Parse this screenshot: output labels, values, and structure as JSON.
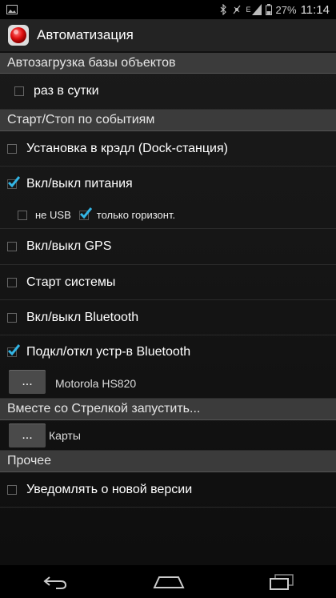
{
  "status_bar": {
    "battery": "27%",
    "clock": "11:14",
    "signal_badge": "E",
    "icons": [
      "image-notification-icon",
      "bluetooth-icon",
      "no-signal-icon",
      "signal-icon",
      "battery-icon"
    ]
  },
  "action_bar": {
    "title": "Автоматизация",
    "icon": "app-logo-icon"
  },
  "sections": {
    "autoload": {
      "title": "Автозагрузка базы объектов",
      "once_a_day": {
        "label": "раз в сутки",
        "checked": false
      }
    },
    "start_stop": {
      "title": "Старт/Стоп по событиям",
      "dock": {
        "label": "Установка в крэдл (Dock-станция)",
        "checked": false
      },
      "power": {
        "label": "Вкл/выкл питания",
        "checked": true
      },
      "no_usb": {
        "label": "не USB",
        "checked": false
      },
      "horizontal_only": {
        "label": "только горизонт.",
        "checked": true
      },
      "gps": {
        "label": "Вкл/выкл GPS",
        "checked": false
      },
      "system_start": {
        "label": "Старт системы",
        "checked": false
      },
      "bluetooth": {
        "label": "Вкл/выкл Bluetooth",
        "checked": false
      },
      "bt_device": {
        "label": "Подкл/откл устр-в Bluetooth",
        "checked": true
      },
      "bt_device_select": {
        "button": "...",
        "value": "Motorola HS820"
      }
    },
    "launch_with": {
      "title": "Вместе со Стрелкой запустить...",
      "app_select": {
        "button": "...",
        "value": "Карты"
      }
    },
    "other": {
      "title": "Прочее",
      "notify_update": {
        "label": "Уведомлять о новой версии",
        "checked": false
      }
    }
  },
  "colors": {
    "checkmark": "#33b5e5",
    "section_bg": "#3b3b3b",
    "action_bar_bg": "#232323"
  },
  "nav_bar": {
    "icons": [
      "back-icon",
      "home-icon",
      "recent-apps-icon"
    ]
  }
}
